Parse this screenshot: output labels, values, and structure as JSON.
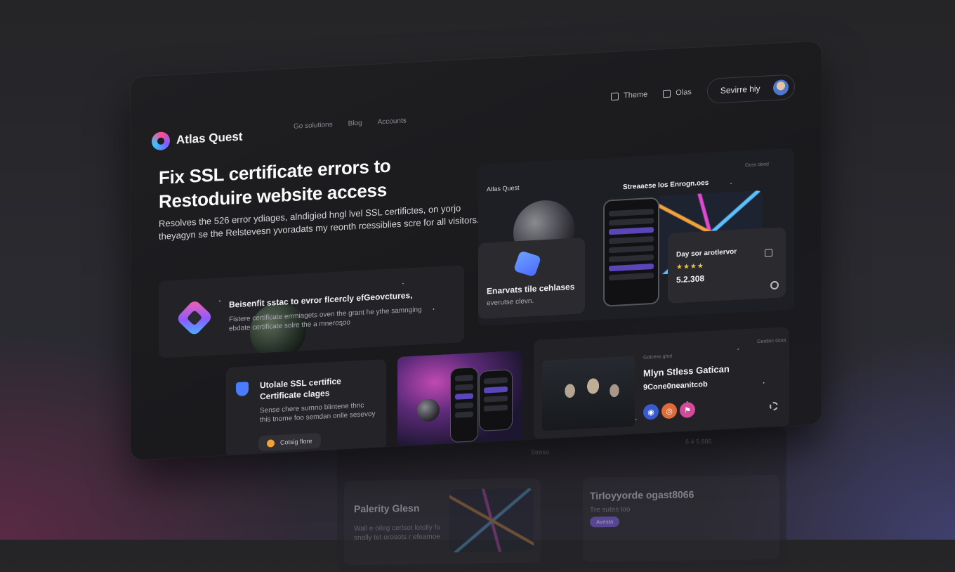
{
  "app": {
    "name": "Atlas Quest"
  },
  "nav": {
    "items": [
      "Go solutions",
      "Blog",
      "Accounts"
    ]
  },
  "topbar": {
    "theme_label": "Theme",
    "docs_label": "Olas",
    "user_label": "Sevirre hiy"
  },
  "hero": {
    "title": "Fix SSL certificate errors to Restoduire website access",
    "subtitle": "Resolves the 526 error ydiages, alndigied hngl lvel SSL certifictes, on yorjo theyagyn se the Relstevesn yvoradats my reonth rcessiblies scre for all visitors."
  },
  "cards": {
    "feature": {
      "title": "Beisenfit sstac to evror flcercly efGeovctures,",
      "text": "Fistere certificate errmiagets oven the grant he ythe samnging ebdate certificate solre the a mnerosoo"
    },
    "enhance": {
      "title": "Enarvats tile cehlases",
      "text": "everutse clevn."
    },
    "preview": {
      "brand": "Atlas Quest",
      "map_title": "Streaaese los Enrogn.oes",
      "tag": "Goss deed"
    },
    "rating": {
      "title": "Day sor arotlervor",
      "stars": "★★★★",
      "value": "5.2.308"
    },
    "update": {
      "title": "Utolale SSL certifice Certificate clages",
      "text": "Sense chere sumno blintene thnc this tnome foo semdan onlle sesevoy",
      "button": "Cotsig flore"
    },
    "mission": {
      "title": "Mlyn Stless Gatican",
      "subtitle": "9Cone0neanitcob",
      "tag": "Geotlec Goot",
      "eyebrow": "Gotcess ghot"
    }
  },
  "ghost": {
    "left_title": "Palerity Glesn",
    "left_text": "Wall e oileg cerlsot lotolly fo snally tet orosots r efeamoe",
    "right_title": "Tirloyyorde ogast8066",
    "right_text": "Tre sutes loo",
    "right_button": "Avesta",
    "metric": "6 4 5 886",
    "tag": "Streso"
  },
  "colors": {
    "accent": "#7b5ce0",
    "star": "#f3c23c",
    "orange": "#f0a23b"
  }
}
